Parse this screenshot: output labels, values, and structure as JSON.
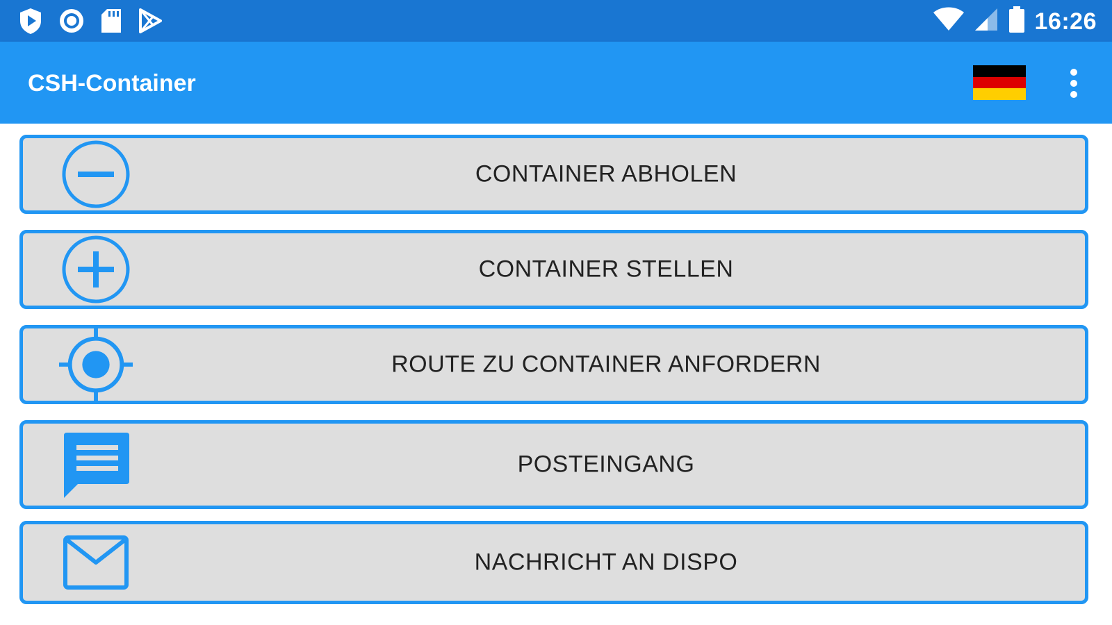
{
  "status_bar": {
    "time": "16:26",
    "left_icons": [
      "shield-play-icon",
      "record-icon",
      "sd-card-icon",
      "play-store-icon"
    ],
    "right_icons": [
      "wifi-icon",
      "cell-signal-icon",
      "battery-icon"
    ]
  },
  "app_bar": {
    "title": "CSH-Container",
    "language_flag": "germany-flag-icon",
    "overflow_icon": "more-vert-icon"
  },
  "menu": {
    "items": [
      {
        "label": "CONTAINER ABHOLEN",
        "icon": "remove-circle-icon"
      },
      {
        "label": "CONTAINER STELLEN",
        "icon": "add-circle-icon"
      },
      {
        "label": "ROUTE ZU CONTAINER ANFORDERN",
        "icon": "my-location-icon"
      },
      {
        "label": "POSTEINGANG",
        "icon": "message-icon"
      },
      {
        "label": "NACHRICHT AN DISPO",
        "icon": "mail-icon"
      }
    ]
  },
  "colors": {
    "status_bar": "#1976d2",
    "app_bar": "#2196f3",
    "button_border": "#2196f3",
    "button_bg": "#dedede",
    "icon": "#2196f3"
  }
}
